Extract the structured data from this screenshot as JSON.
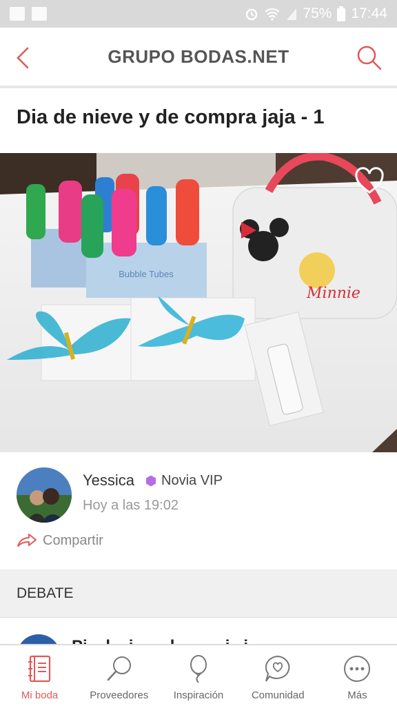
{
  "status_bar": {
    "battery": "75%",
    "time": "17:44"
  },
  "header": {
    "title": "GRUPO BODAS.NET"
  },
  "post": {
    "title": "Dia de nieve y de compra jaja - 1",
    "photo_text": {
      "product_label": "Bubble Tubes",
      "bag_label": "Minnie"
    }
  },
  "author": {
    "name": "Yessica",
    "badge": "Novia VIP",
    "time": "Hoy a las 19:02"
  },
  "share": {
    "label": "Compartir"
  },
  "debate": {
    "label": "DEBATE"
  },
  "next_post": {
    "title_fragment": "Pi... l... i... ... l... ... ...i...i..."
  },
  "tabs": [
    {
      "label": "Mi boda",
      "icon": "notebook-icon",
      "active": true
    },
    {
      "label": "Proveedores",
      "icon": "magnifier-icon",
      "active": false
    },
    {
      "label": "Inspiración",
      "icon": "balloon-icon",
      "active": false
    },
    {
      "label": "Comunidad",
      "icon": "chat-heart-icon",
      "active": false
    },
    {
      "label": "Más",
      "icon": "more-dots-icon",
      "active": false
    }
  ],
  "colors": {
    "accent": "#e05a5a",
    "badge": "#b56ce6",
    "header_text": "#555555"
  }
}
